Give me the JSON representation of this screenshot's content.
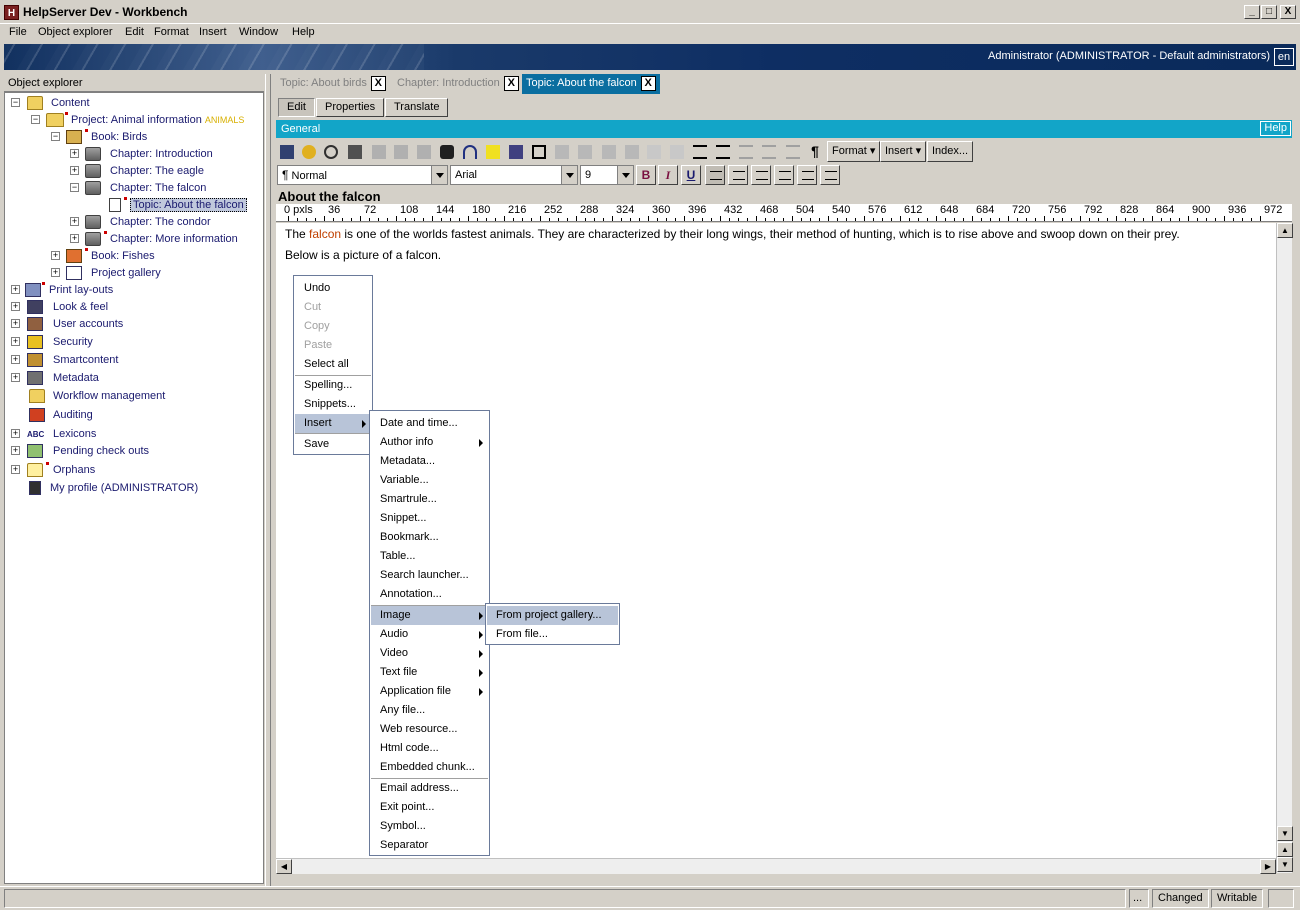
{
  "window": {
    "title": "HelpServer Dev - Workbench",
    "icon_glyph": "H"
  },
  "window_buttons": {
    "minimize": "_",
    "maximize": "□",
    "close": "X"
  },
  "menubar": [
    "File",
    "Object explorer",
    "Edit",
    "Format",
    "Insert",
    "Window",
    "Help"
  ],
  "banner": {
    "user_info": "Administrator (ADMINISTRATOR - Default administrators)",
    "language": "en"
  },
  "explorer": {
    "header": "Object explorer",
    "tree": {
      "content": "Content",
      "project": "Project: Animal information",
      "project_badge": "ANIMALS",
      "book_birds": "Book: Birds",
      "ch_intro": "Chapter: Introduction",
      "ch_eagle": "Chapter: The eagle",
      "ch_falcon": "Chapter: The falcon",
      "topic_falcon": "Topic: About the falcon",
      "ch_condor": "Chapter: The condor",
      "ch_more": "Chapter: More information",
      "book_fishes": "Book: Fishes",
      "gallery": "Project gallery",
      "print": "Print lay-outs",
      "look": "Look & feel",
      "users": "User accounts",
      "security": "Security",
      "smart": "Smartcontent",
      "metadata": "Metadata",
      "workflow": "Workflow management",
      "auditing": "Auditing",
      "lexicons": "Lexicons",
      "pending": "Pending check outs",
      "orphans": "Orphans",
      "profile": "My profile (ADMINISTRATOR)"
    }
  },
  "doc_tabs": [
    {
      "label": "Topic: About birds",
      "close": "X"
    },
    {
      "label": "Chapter: Introduction",
      "close": "X"
    },
    {
      "label": "Topic: About the falcon",
      "close": "X"
    }
  ],
  "sub_tabs": [
    "Edit",
    "Properties",
    "Translate"
  ],
  "general": {
    "label": "General",
    "help": "Help"
  },
  "toolbar": {
    "format": "Format",
    "insert": "Insert",
    "index": "Index...",
    "paragraph_mark": "¶",
    "style_value": "Normal",
    "font_value": "Arial",
    "size_value": "9",
    "bold": "B",
    "italic": "I",
    "underline": "U"
  },
  "editor": {
    "title": "About the falcon",
    "ruler_unit": "0 pxls",
    "ruler_ticks": [
      "36",
      "72",
      "108",
      "144",
      "180",
      "216",
      "252",
      "288",
      "324",
      "360",
      "396",
      "432",
      "468",
      "504",
      "540",
      "576",
      "612",
      "648",
      "684",
      "720",
      "756",
      "792",
      "828",
      "864",
      "900",
      "936",
      "972"
    ],
    "p1_before": "The ",
    "p1_highlight": "falcon",
    "p1_after": " is one of the worlds fastest animals. They are characterized by their long wings, their method of hunting, which is to rise above and swoop down on their prey.",
    "p2": "Below is a picture of a falcon."
  },
  "context_menu": {
    "undo": "Undo",
    "cut": "Cut",
    "copy": "Copy",
    "paste": "Paste",
    "select_all": "Select all",
    "spelling": "Spelling...",
    "snippets": "Snippets...",
    "insert": "Insert",
    "save": "Save"
  },
  "insert_menu": {
    "date_time": "Date and time...",
    "author_info": "Author info",
    "metadata": "Metadata...",
    "variable": "Variable...",
    "smartrule": "Smartrule...",
    "snippet": "Snippet...",
    "bookmark": "Bookmark...",
    "table": "Table...",
    "search_launcher": "Search launcher...",
    "annotation": "Annotation...",
    "image": "Image",
    "audio": "Audio",
    "video": "Video",
    "text_file": "Text file",
    "application_file": "Application file",
    "any_file": "Any file...",
    "web_resource": "Web resource...",
    "html_code": "Html code...",
    "embedded_chunk": "Embedded chunk...",
    "email": "Email address...",
    "exit_point": "Exit point...",
    "symbol": "Symbol...",
    "separator": "Separator"
  },
  "image_menu": {
    "from_gallery": "From project gallery...",
    "from_file": "From file..."
  },
  "statusbar": {
    "ellipsis": "...",
    "changed": "Changed",
    "writable": "Writable"
  }
}
